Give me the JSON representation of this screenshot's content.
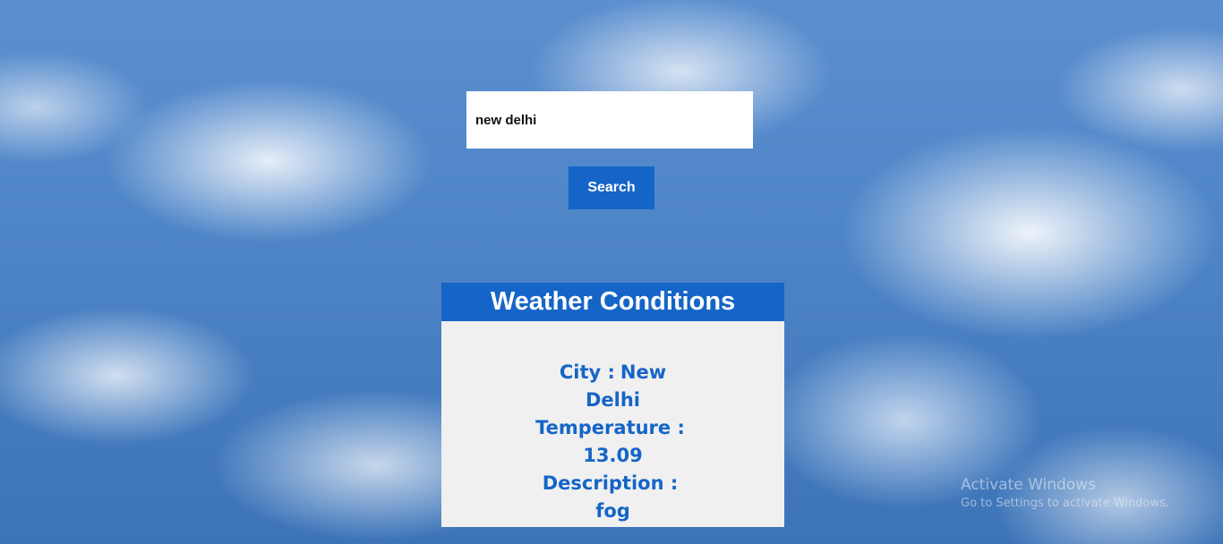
{
  "search": {
    "value": "new delhi",
    "button_label": "Search"
  },
  "weather": {
    "title": "Weather Conditions",
    "city_label": "City :",
    "city": "New Delhi",
    "temperature_label": "Temperature :",
    "temperature": "13.09",
    "description_label": "Description :",
    "description": "fog"
  },
  "watermark": {
    "title": "Activate Windows",
    "subtitle": "Go to Settings to activate Windows."
  },
  "colors": {
    "accent": "#1565c8",
    "card_background": "#f0f0f0"
  }
}
